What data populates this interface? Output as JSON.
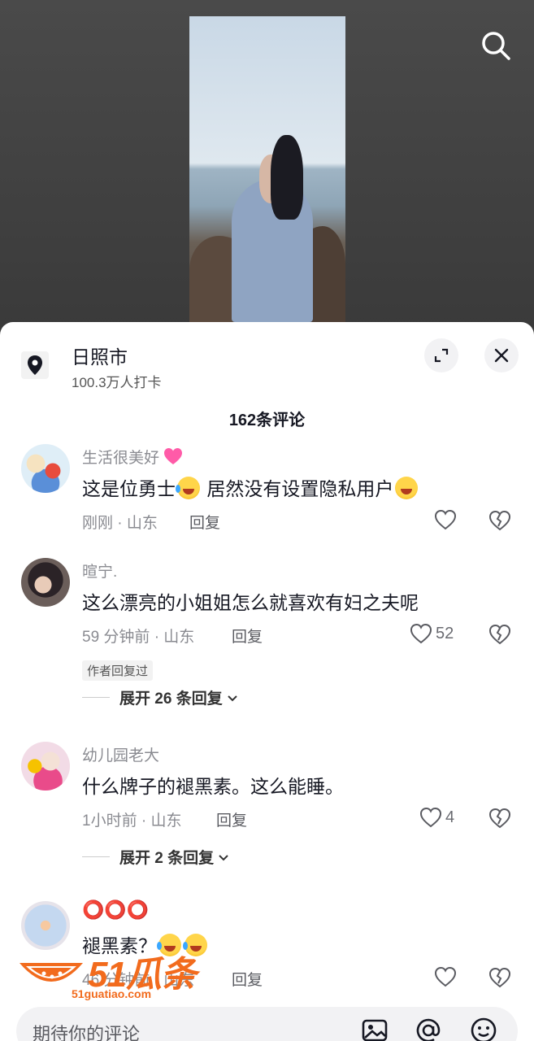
{
  "location": {
    "name": "日照市",
    "checkins": "100.3万人打卡"
  },
  "comments_header": "162条评论",
  "comments": [
    {
      "user": "生活很美好",
      "text_a": "这是位勇士",
      "text_b": " 居然没有设置隐私用户",
      "time_location": "刚刚 · 山东",
      "reply": "回复",
      "likes": ""
    },
    {
      "user": "暄宁.",
      "text": "这么漂亮的小姐姐怎么就喜欢有妇之夫呢",
      "time_location": "59 分钟前 · 山东",
      "reply": "回复",
      "likes": "52",
      "author_tag": "作者回复过",
      "expand": "展开 26 条回复"
    },
    {
      "user": "幼儿园老大",
      "text": "什么牌子的褪黑素。这么能睡。",
      "time_location": "1小时前 · 山东",
      "reply": "回复",
      "likes": "4",
      "expand": "展开 2 条回复"
    },
    {
      "user": "⭕⭕⭕",
      "text": "褪黑素？",
      "time_location": "46 分钟前 · 山东",
      "reply": "回复",
      "likes": ""
    }
  ],
  "watermark": {
    "main": "51瓜条",
    "sub": "51guatiao.com"
  },
  "input": {
    "placeholder": "期待你的评论"
  },
  "colors": {
    "accent": "#f26b1d",
    "text_primary": "#161823",
    "text_secondary": "#8a8b91"
  }
}
